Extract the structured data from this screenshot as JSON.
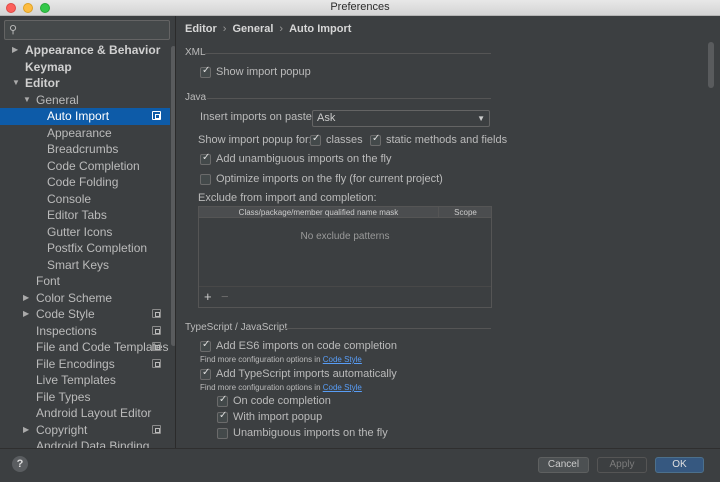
{
  "window": {
    "title": "Preferences"
  },
  "sidebar": {
    "search_placeholder": "",
    "items": [
      {
        "label": "Appearance & Behavior",
        "arrow": "▶",
        "bold": true
      },
      {
        "label": "Keymap",
        "arrow": "",
        "bold": true
      },
      {
        "label": "Editor",
        "arrow": "▼",
        "bold": true
      },
      {
        "label": "General",
        "arrow": "▼",
        "bold": false
      },
      {
        "label": "Auto Import",
        "arrow": "",
        "bold": false,
        "selected": true,
        "icon": "copy-icon"
      },
      {
        "label": "Appearance",
        "arrow": "",
        "bold": false
      },
      {
        "label": "Breadcrumbs",
        "arrow": "",
        "bold": false
      },
      {
        "label": "Code Completion",
        "arrow": "",
        "bold": false
      },
      {
        "label": "Code Folding",
        "arrow": "",
        "bold": false
      },
      {
        "label": "Console",
        "arrow": "",
        "bold": false
      },
      {
        "label": "Editor Tabs",
        "arrow": "",
        "bold": false
      },
      {
        "label": "Gutter Icons",
        "arrow": "",
        "bold": false
      },
      {
        "label": "Postfix Completion",
        "arrow": "",
        "bold": false
      },
      {
        "label": "Smart Keys",
        "arrow": "",
        "bold": false
      },
      {
        "label": "Font",
        "arrow": "",
        "bold": false
      },
      {
        "label": "Color Scheme",
        "arrow": "▶",
        "bold": false
      },
      {
        "label": "Code Style",
        "arrow": "▶",
        "bold": false,
        "icon": "copy-icon"
      },
      {
        "label": "Inspections",
        "arrow": "",
        "bold": false,
        "icon": "copy-icon"
      },
      {
        "label": "File and Code Templates",
        "arrow": "",
        "bold": false,
        "icon": "copy-icon"
      },
      {
        "label": "File Encodings",
        "arrow": "",
        "bold": false,
        "icon": "copy-icon"
      },
      {
        "label": "Live Templates",
        "arrow": "",
        "bold": false
      },
      {
        "label": "File Types",
        "arrow": "",
        "bold": false
      },
      {
        "label": "Android Layout Editor",
        "arrow": "",
        "bold": false
      },
      {
        "label": "Copyright",
        "arrow": "▶",
        "bold": false,
        "icon": "copy-icon"
      },
      {
        "label": "Android Data Binding",
        "arrow": "",
        "bold": false
      }
    ]
  },
  "breadcrumb": {
    "part1": "Editor",
    "part2": "General",
    "part3": "Auto Import"
  },
  "xml": {
    "section": "XML",
    "show_import_popup": {
      "label": "Show import popup",
      "checked": true
    }
  },
  "java": {
    "section": "Java",
    "insert_on_paste_label": "Insert imports on paste:",
    "insert_on_paste_value": "Ask",
    "show_popup_for_label": "Show import popup for:",
    "classes": {
      "label": "classes",
      "checked": true
    },
    "static_methods": {
      "label": "static methods and fields",
      "checked": true
    },
    "add_unambiguous": {
      "label": "Add unambiguous imports on the fly",
      "checked": true
    },
    "optimize": {
      "label": "Optimize imports on the fly (for current project)",
      "checked": false
    },
    "exclude_label": "Exclude from import and completion:",
    "table": {
      "col1": "Class/package/member qualified name mask",
      "col2": "Scope",
      "empty": "No exclude patterns",
      "add": "+",
      "remove": "−"
    }
  },
  "ts": {
    "section": "TypeScript / JavaScript",
    "es6": {
      "label": "Add ES6 imports on code completion",
      "checked": true
    },
    "hint1_text": "Find more configuration options in ",
    "hint1_link": "Code Style",
    "ts_auto": {
      "label": "Add TypeScript imports automatically",
      "checked": true
    },
    "hint2_text": "Find more configuration options in ",
    "hint2_link": "Code Style",
    "on_completion": {
      "label": "On code completion",
      "checked": true
    },
    "with_popup": {
      "label": "With import popup",
      "checked": true
    },
    "unambiguous": {
      "label": "Unambiguous imports on the fly",
      "checked": false
    }
  },
  "footer": {
    "help": "?",
    "cancel": "Cancel",
    "apply": "Apply",
    "ok": "OK"
  },
  "colors": {
    "selection": "#0d5ba8",
    "link": "#589df6",
    "ok_button": "#365880"
  }
}
